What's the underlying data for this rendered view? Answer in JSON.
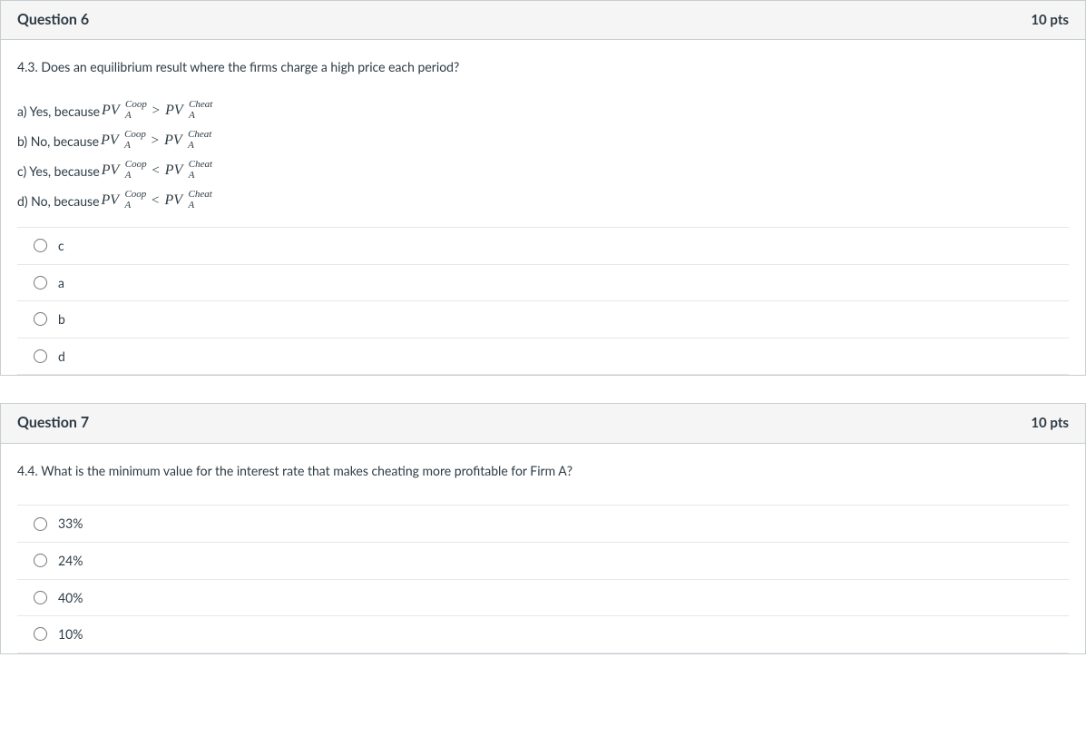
{
  "q6": {
    "header_title": "Question 6",
    "points": "10 pts",
    "prompt": "4.3. Does an equilibrium result where the firms charge a high price each period?",
    "lines": [
      {
        "prefix": "a) Yes, because ",
        "op": ">"
      },
      {
        "prefix": "b) No, because ",
        "op": ">"
      },
      {
        "prefix": "c) Yes, because ",
        "op": "<"
      },
      {
        "prefix": "d) No, because ",
        "op": "<"
      }
    ],
    "pv_base": "PV",
    "pv_sub": "A",
    "pv_sup_coop": "Coop",
    "pv_sup_cheat": "Cheat",
    "options": [
      "c",
      "a",
      "b",
      "d"
    ]
  },
  "q7": {
    "header_title": "Question 7",
    "points": "10 pts",
    "prompt": "4.4. What is the minimum value for the interest rate that makes cheating more profitable for Firm A?",
    "options": [
      "33%",
      "24%",
      "40%",
      "10%"
    ]
  }
}
